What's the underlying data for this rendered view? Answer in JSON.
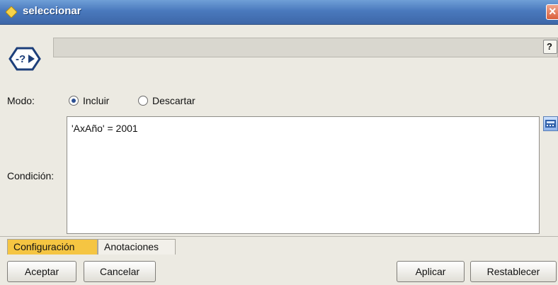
{
  "window": {
    "title": "seleccionar"
  },
  "header": {
    "help_icon": "help-icon",
    "node_icon": "select-node-icon"
  },
  "form": {
    "modo_label": "Modo:",
    "options": [
      {
        "label": "Incluir",
        "selected": true
      },
      {
        "label": "Descartar",
        "selected": false
      }
    ],
    "condicion_label": "Condición:",
    "condicion_value": "'AxAño' = 2001"
  },
  "tabs": [
    {
      "label": "Configuración",
      "active": true
    },
    {
      "label": "Anotaciones",
      "active": false
    }
  ],
  "buttons": {
    "aceptar": "Aceptar",
    "cancelar": "Cancelar",
    "aplicar": "Aplicar",
    "restablecer": "Restablecer"
  },
  "colors": {
    "titlebar": "#4a79bd",
    "active_tab": "#f5c542"
  }
}
